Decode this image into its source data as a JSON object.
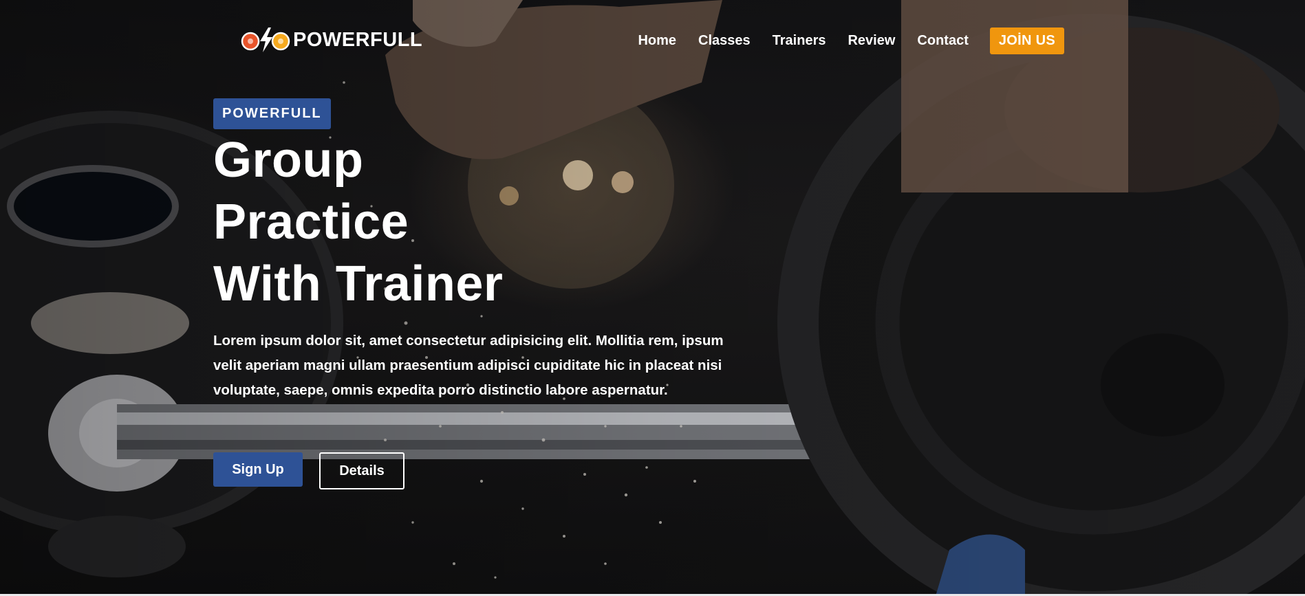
{
  "brand": {
    "logo_text": "POWERFULL",
    "logo_icon": "dumbbell-bolt-icon"
  },
  "nav": {
    "items": [
      "Home",
      "Classes",
      "Trainers",
      "Review",
      "Contact"
    ],
    "join_label": "JOİN US"
  },
  "hero": {
    "badge": "POWERFULL",
    "headline_lines": [
      "Group",
      "Practice",
      "With Trainer"
    ],
    "description": "Lorem ipsum dolor sit, amet consectetur adipisicing elit. Mollitia rem, ipsum velit aperiam magni ullam praesentium adipisci cupiditate hic in placeat nisi voluptate, saepe, omnis expedita porro distinctio labore aspernatur.",
    "primary_button": "Sign Up",
    "secondary_button": "Details",
    "background_image": "gym-barbell-chalk-photo"
  },
  "colors": {
    "accent_blue": "#2e5296",
    "accent_orange": "#f0960e",
    "text": "#ffffff"
  }
}
